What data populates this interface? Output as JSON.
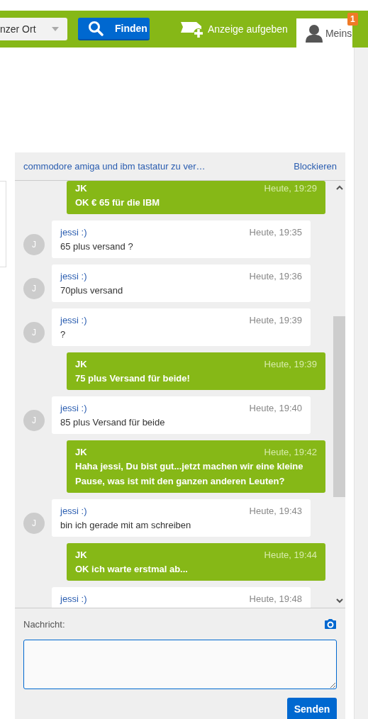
{
  "header": {
    "location_select": "nzer Ort",
    "search_button": "Finden",
    "post_ad": "Anzeige aufgeben",
    "account_tab": {
      "label": "Meins",
      "badge": "1",
      "selected": true
    }
  },
  "chat": {
    "title": "commodore amiga und ibm tastatur zu ver…",
    "block": "Blockieren",
    "messages": [
      {
        "kind": "outgoing",
        "sender": "JK",
        "time": "Heute, 19:29",
        "text": "OK € 65 für die IBM"
      },
      {
        "kind": "incoming",
        "avatar": "J",
        "sender": "jessi :)",
        "time": "Heute, 19:35",
        "text": "65 plus versand ?"
      },
      {
        "kind": "incoming",
        "avatar": "J",
        "sender": "jessi :)",
        "time": "Heute, 19:36",
        "text": "70plus versand"
      },
      {
        "kind": "incoming",
        "avatar": "J",
        "sender": "jessi :)",
        "time": "Heute, 19:39",
        "text": "?"
      },
      {
        "kind": "outgoing",
        "sender": "JK",
        "time": "Heute, 19:39",
        "text": "75 plus Versand für beide!"
      },
      {
        "kind": "incoming",
        "avatar": "J",
        "sender": "jessi :)",
        "time": "Heute, 19:40",
        "text": "85 plus Versand für beide"
      },
      {
        "kind": "outgoing",
        "sender": "JK",
        "time": "Heute, 19:42",
        "text": "Haha jessi, Du bist gut...jetzt machen wir eine kleine Pause, was ist mit den ganzen anderen Leuten?"
      },
      {
        "kind": "incoming",
        "avatar": "J",
        "sender": "jessi :)",
        "time": "Heute, 19:43",
        "text": "bin ich gerade mit am schreiben"
      },
      {
        "kind": "outgoing",
        "sender": "JK",
        "time": "Heute, 19:44",
        "text": "OK ich warte erstmal ab..."
      },
      {
        "kind": "incoming",
        "sender": "jessi :)",
        "time": "Heute, 19:48"
      }
    ],
    "composer": {
      "label": "Nachricht:",
      "send_button": "Senden"
    }
  }
}
